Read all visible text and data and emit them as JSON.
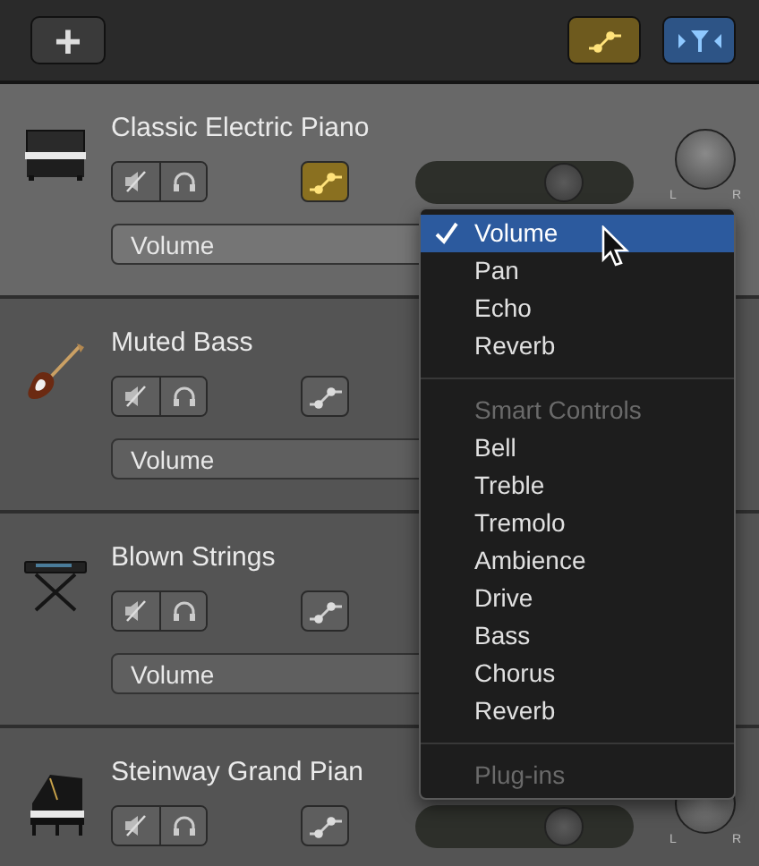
{
  "toolbar": {
    "add_button": "+",
    "automation_on": true,
    "filter_on": true
  },
  "tracks": [
    {
      "name": "Classic Electric Piano",
      "kind": "upright-piano",
      "selected": true,
      "automation": true,
      "level": 0.72,
      "knob_labels": [
        "L",
        "R"
      ],
      "control": "Volume"
    },
    {
      "name": "Muted Bass",
      "kind": "guitar",
      "selected": false,
      "automation": false,
      "control": "Volume"
    },
    {
      "name": "Blown Strings",
      "kind": "keyboard-stand",
      "selected": false,
      "automation": false,
      "control": "Volume"
    },
    {
      "name": "Steinway Grand Pian",
      "kind": "grand-piano",
      "selected": false,
      "automation": false,
      "level": 0.72,
      "knob_labels": [
        "L",
        "R"
      ]
    }
  ],
  "menu": {
    "sections": [
      {
        "items": [
          {
            "label": "Volume",
            "selected": true
          },
          {
            "label": "Pan",
            "selected": false
          },
          {
            "label": "Echo",
            "selected": false
          },
          {
            "label": "Reverb",
            "selected": false
          }
        ]
      },
      {
        "header": "Smart Controls",
        "items": [
          {
            "label": "Bell",
            "selected": false
          },
          {
            "label": "Treble",
            "selected": false
          },
          {
            "label": "Tremolo",
            "selected": false
          },
          {
            "label": "Ambience",
            "selected": false
          },
          {
            "label": "Drive",
            "selected": false
          },
          {
            "label": "Bass",
            "selected": false
          },
          {
            "label": "Chorus",
            "selected": false
          },
          {
            "label": "Reverb",
            "selected": false
          }
        ]
      },
      {
        "header": "Plug-ins"
      }
    ]
  }
}
